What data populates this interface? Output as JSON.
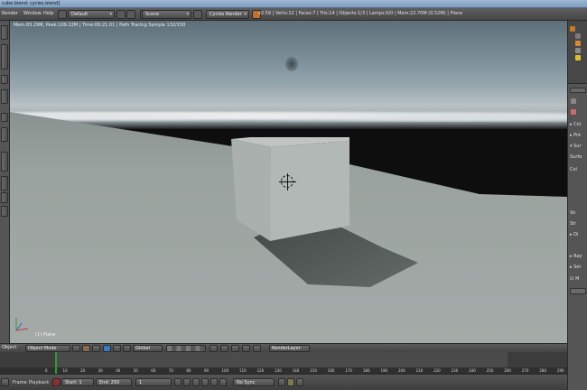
{
  "window": {
    "title": "cube.blend: cycles.blend]"
  },
  "menu": [
    "Render",
    "Window",
    "Help"
  ],
  "layout_select": "Default",
  "scene_select": "Scene",
  "engine_select": "Cycles Render",
  "stats": "v2.59 | Verts:12 | Faces:7 | Tris:14 | Objects:1/3 | Lamps:0/0 | Mem:22.70M (0.52M) | Plane",
  "viewport": {
    "render_info": "Mem:83.29M, Peak:109.22M | Time:00:21.01 | Path Tracing Sample 132/150",
    "object_label": "(1) Plane"
  },
  "view_header": {
    "frag_left": "Object",
    "mode": "Object Mode",
    "pivot_orient": "Global",
    "render_layer": "RenderLayer"
  },
  "timeline": {
    "ticks": [
      "0",
      "10",
      "20",
      "30",
      "40",
      "50",
      "60",
      "70",
      "80",
      "90",
      "100",
      "110",
      "120",
      "130",
      "140",
      "150",
      "160",
      "170",
      "180",
      "190",
      "200",
      "210",
      "220",
      "230",
      "240",
      "250",
      "260",
      "270",
      "280",
      "290"
    ],
    "current_frame_value": 1
  },
  "bottom": {
    "menu": [
      "Frame",
      "Playback"
    ],
    "start": "Start: 1",
    "end": "End: 250",
    "current": "1",
    "sync": "No Sync"
  },
  "colors": {
    "playhead": "#2f9a3b",
    "viewport_bg": "#0e0e0e",
    "accent_orange": "#d98a2a",
    "accent_blue": "#3a78c2"
  },
  "icons": [
    "blender-logo-icon",
    "render-icon",
    "scene-icon",
    "cursor-icon",
    "camera-icon",
    "lamp-icon",
    "object-icon",
    "play-icon",
    "record-icon",
    "key-icon"
  ]
}
